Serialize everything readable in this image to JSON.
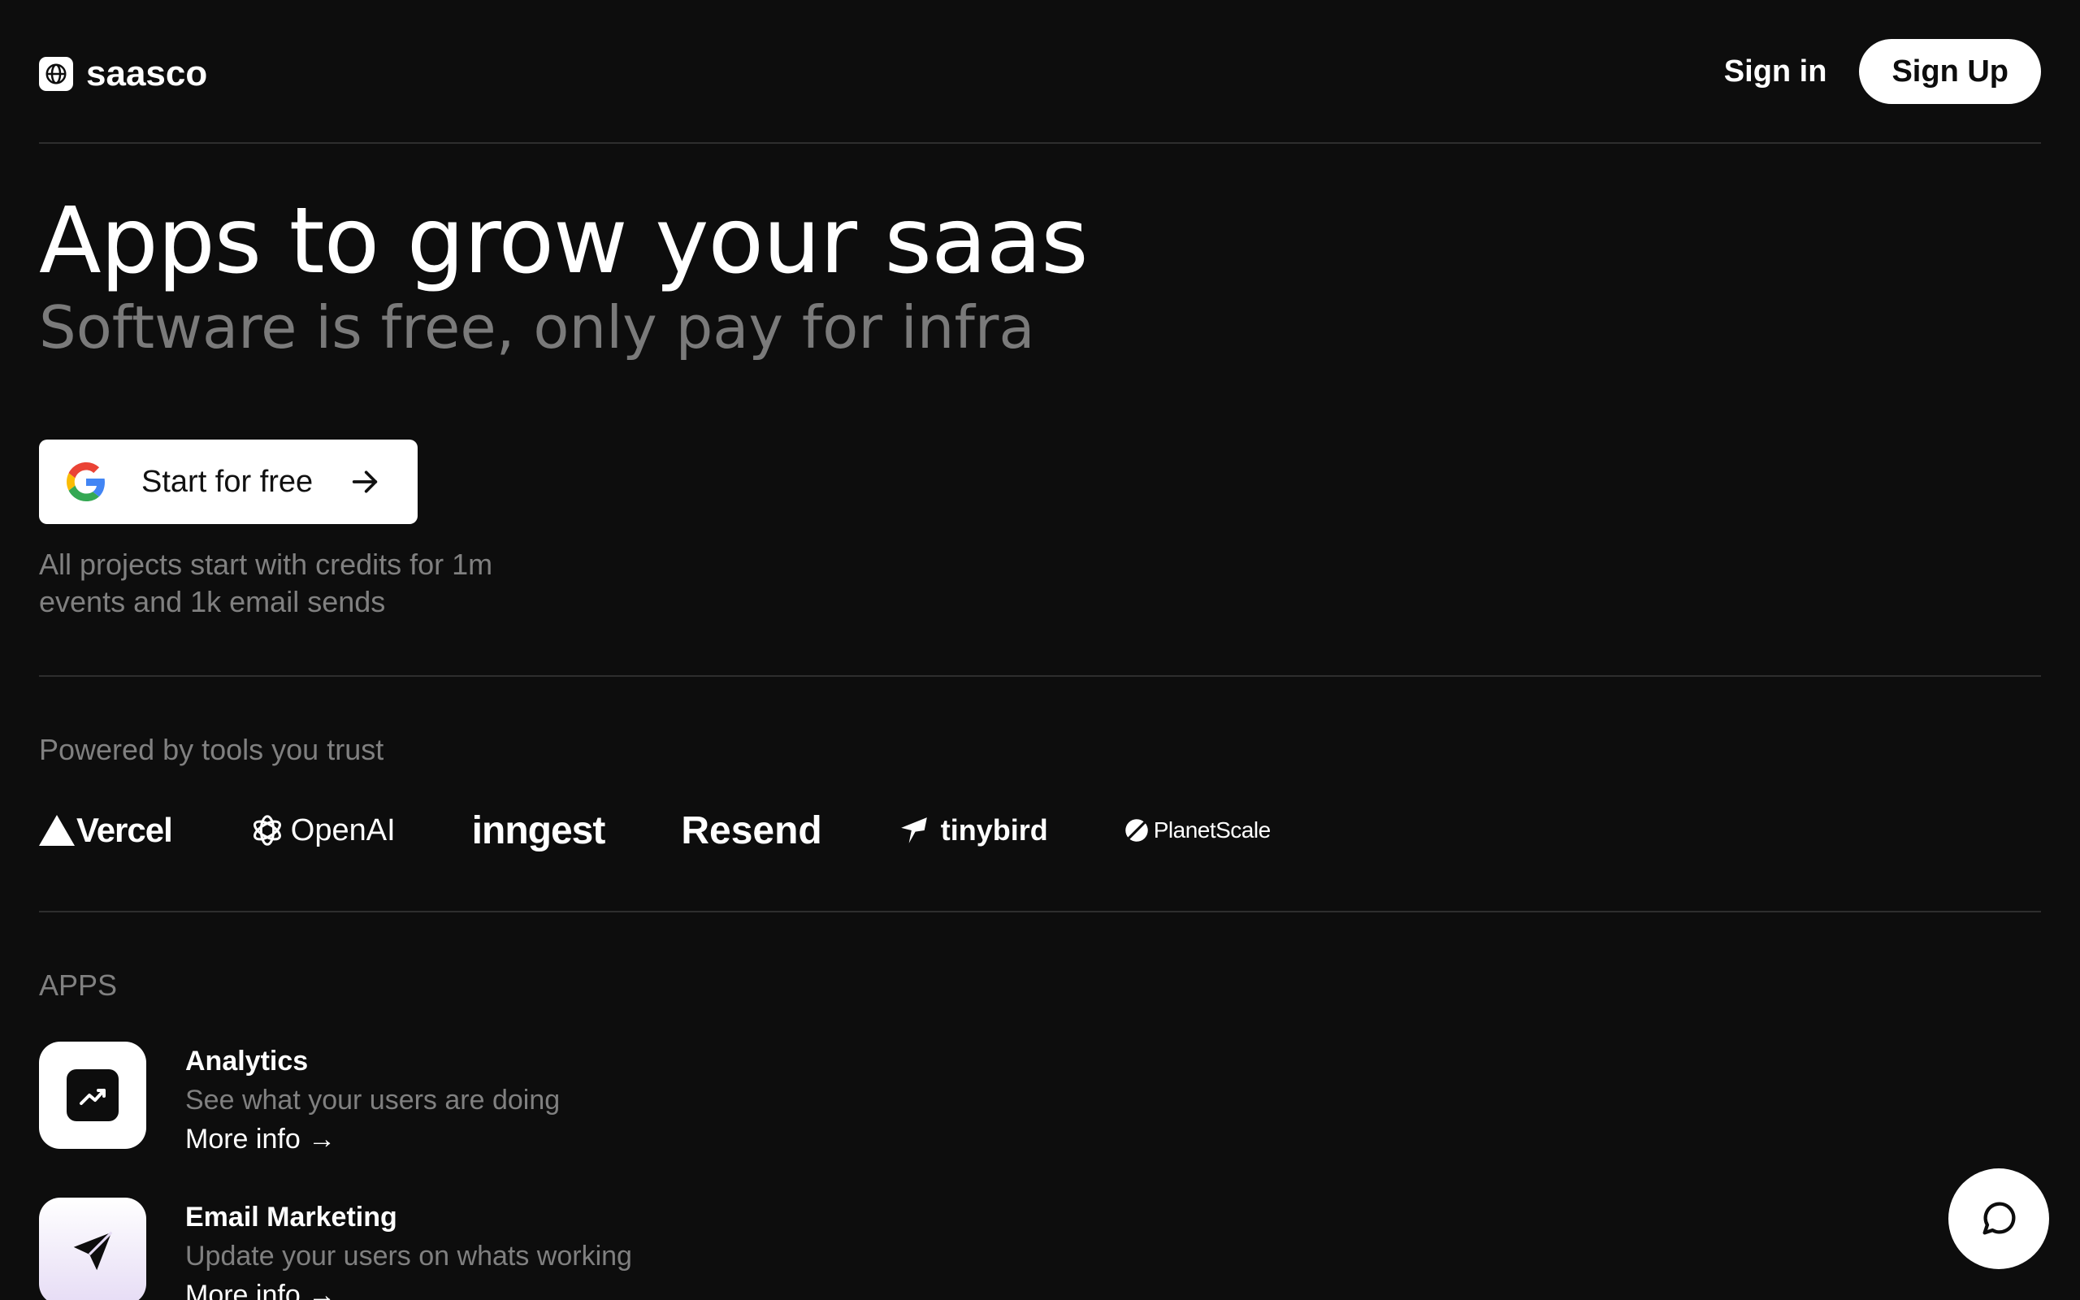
{
  "header": {
    "brand": "saasco",
    "sign_in_label": "Sign in",
    "sign_up_label": "Sign Up"
  },
  "hero": {
    "title": "Apps to grow your saas",
    "subtitle": "Software is free, only pay for infra",
    "cta_label": "Start for free",
    "note": "All projects start with credits for 1m events and 1k email sends"
  },
  "powered": {
    "label": "Powered by tools you trust",
    "brands": [
      "Vercel",
      "OpenAI",
      "inngest",
      "Resend",
      "tinybird",
      "PlanetScale"
    ]
  },
  "apps": {
    "label": "APPS",
    "items": [
      {
        "name": "Analytics",
        "description": "See what your users are doing",
        "link": "More info →",
        "icon": "trending-up-icon"
      },
      {
        "name": "Email Marketing",
        "description": "Update your users on whats working",
        "link": "More info →",
        "icon": "send-icon"
      }
    ]
  },
  "chat": {
    "icon": "chat-bubble-icon"
  },
  "colors": {
    "background": "#0d0d0d",
    "text": "#ffffff",
    "muted": "#808080",
    "divider": "#2e2e2e"
  }
}
